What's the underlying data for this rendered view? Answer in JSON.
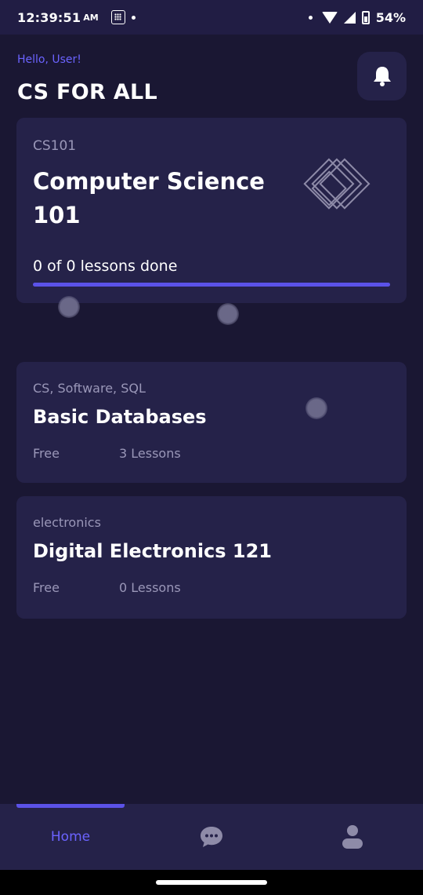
{
  "status_bar": {
    "time": "12:39:51",
    "ampm": "AM",
    "battery": "54%",
    "icons": [
      "app-grid-icon",
      "notification-dot-icon",
      "wifi-icon",
      "signal-icon",
      "battery-charging-icon"
    ]
  },
  "header": {
    "greeting": "Hello, User!",
    "title": "CS FOR ALL",
    "notification_icon": "bell-icon"
  },
  "featured_course": {
    "code": "CS101",
    "title": "Computer Science 101",
    "progress_text": "0 of 0 lessons done",
    "progress_fraction": 1.0,
    "logo_icon": "diamond-stack-icon"
  },
  "courses": [
    {
      "tags": "CS, Software, SQL",
      "title": "Basic Databases",
      "price": "Free",
      "lessons": "3 Lessons"
    },
    {
      "tags": "electronics",
      "title": "Digital Electronics 121",
      "price": "Free",
      "lessons": "0 Lessons"
    }
  ],
  "bottom_nav": {
    "home_label": "Home",
    "chat_icon": "chat-bubble-icon",
    "profile_icon": "user-icon",
    "active": "home"
  },
  "colors": {
    "background": "#1a1733",
    "card": "#252249",
    "accent": "#5b52e8",
    "accent_text": "#6b63ff",
    "muted_text": "#9a97b8"
  }
}
